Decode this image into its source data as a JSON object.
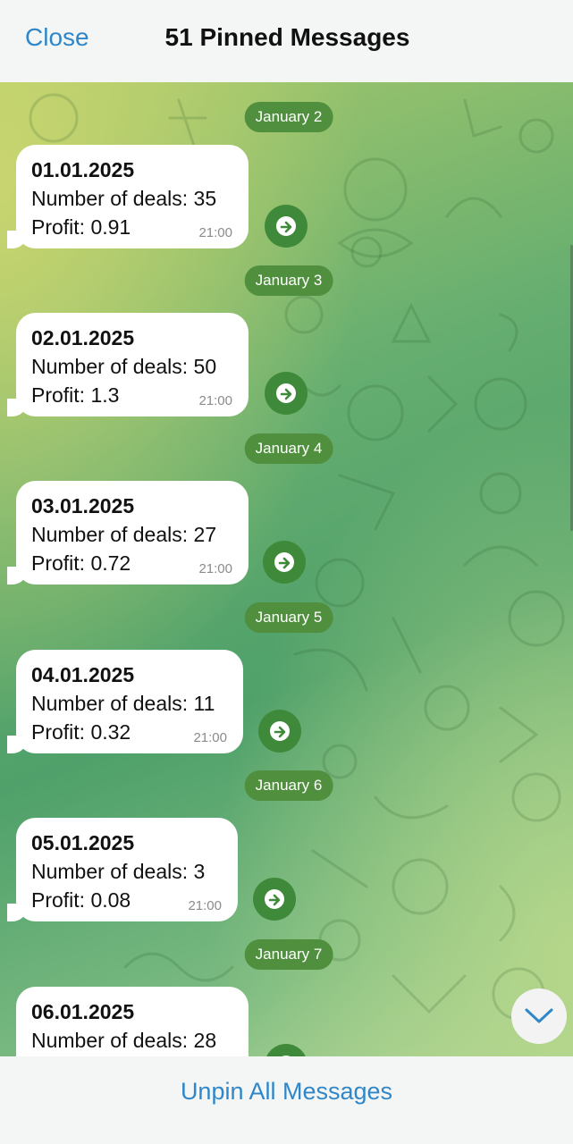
{
  "header": {
    "close_label": "Close",
    "title": "51 Pinned Messages"
  },
  "messages": [
    {
      "date_separator": "January 2",
      "title": "01.01.2025",
      "deals": "Number of deals: 35",
      "profit": "Profit: 0.91",
      "time": "21:00"
    },
    {
      "date_separator": "January 3",
      "title": "02.01.2025",
      "deals": "Number of deals: 50",
      "profit": "Profit: 1.3",
      "time": "21:00"
    },
    {
      "date_separator": "January 4",
      "title": "03.01.2025",
      "deals": "Number of deals: 27",
      "profit": "Profit: 0.72",
      "time": "21:00"
    },
    {
      "date_separator": "January 5",
      "title": "04.01.2025",
      "deals": "Number of deals: 11",
      "profit": "Profit: 0.32",
      "time": "21:00"
    },
    {
      "date_separator": "January 6",
      "title": "05.01.2025",
      "deals": "Number of deals: 3",
      "profit": "Profit: 0.08",
      "time": "21:00"
    },
    {
      "date_separator": "January 7",
      "title": "06.01.2025",
      "deals": "Number of deals: 28"
    }
  ],
  "footer": {
    "unpin_label": "Unpin All Messages"
  },
  "icons": {
    "forward": "forward-arrow-icon",
    "scroll_down": "chevron-down-icon"
  },
  "colors": {
    "accent": "#2f87c9",
    "date_pill": "#4f8f3e",
    "forward_button": "#3f8a3a"
  }
}
